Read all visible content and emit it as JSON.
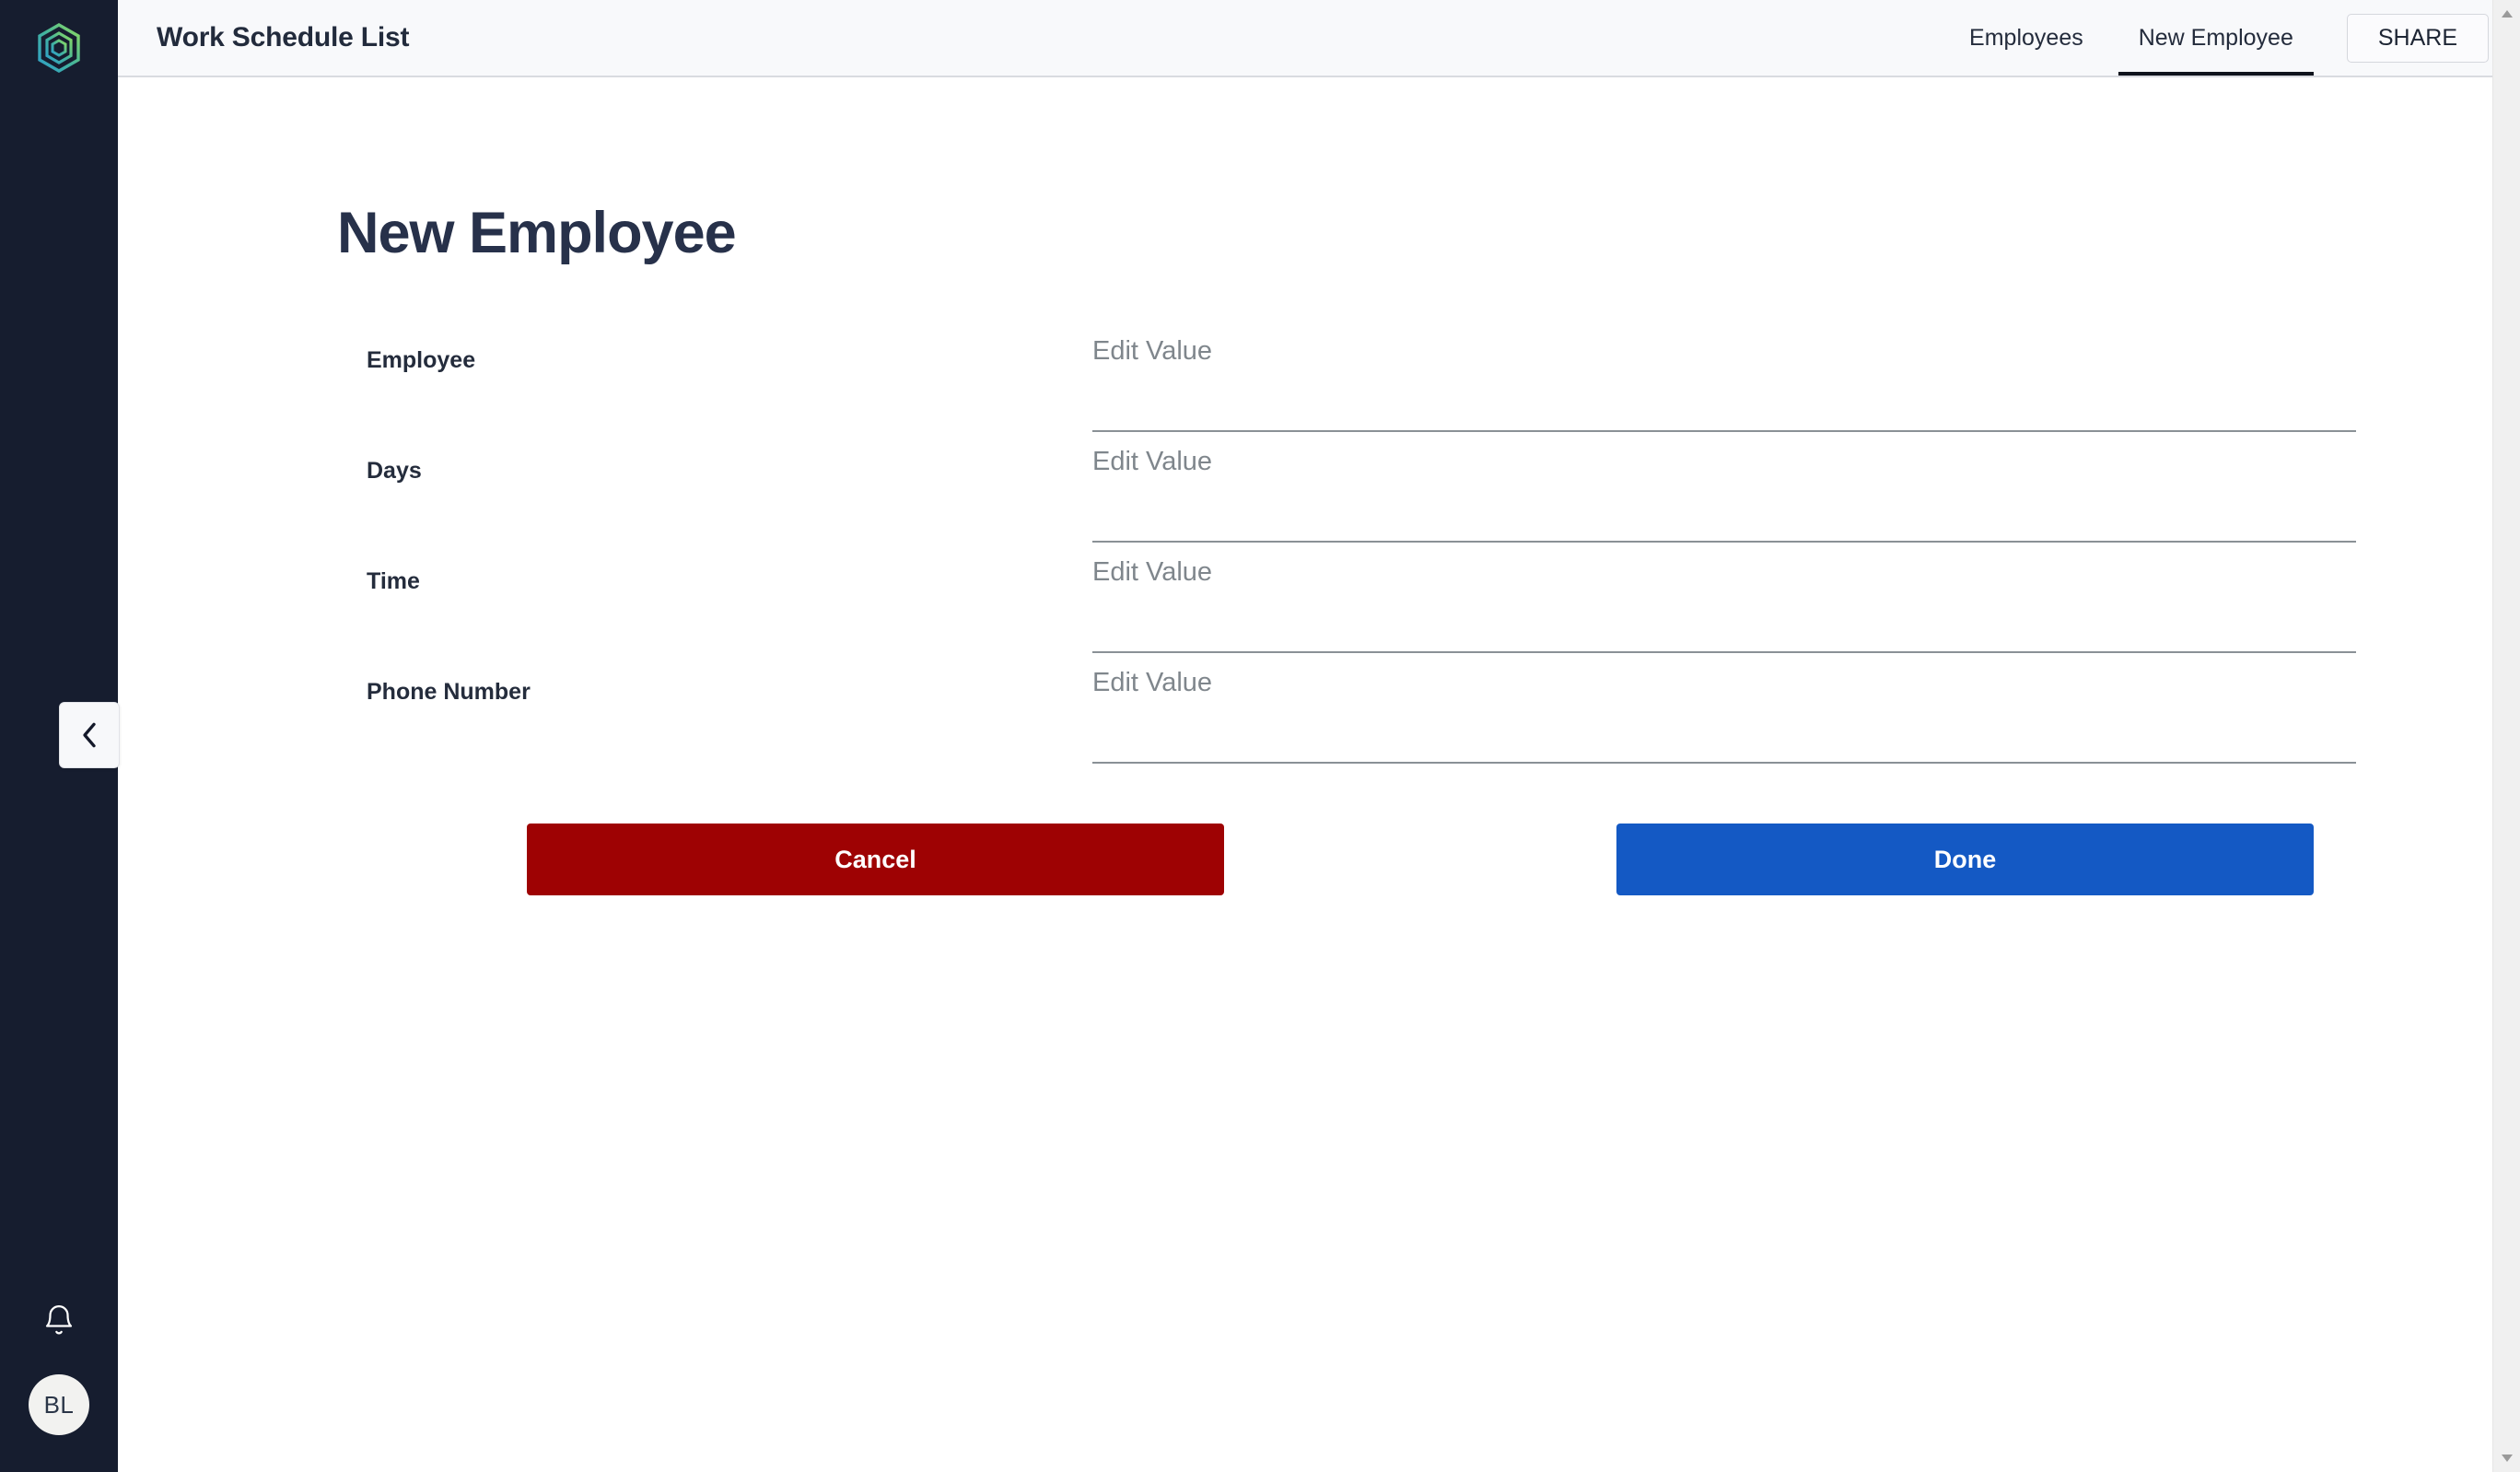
{
  "app": {
    "logo_icon": "hexagon-logo-icon",
    "rail_bg": "#161d2f",
    "accent_teal": "#3aa6c0",
    "accent_green": "#7fd465"
  },
  "sidebar": {
    "notifications_icon": "bell-icon",
    "avatar_initials": "BL",
    "collapse_icon": "chevron-left-icon"
  },
  "header": {
    "title": "Work Schedule List",
    "tabs": [
      {
        "label": "Employees",
        "active": false
      },
      {
        "label": "New Employee",
        "active": true
      }
    ],
    "share_label": "SHARE"
  },
  "main": {
    "page_title": "New Employee",
    "fields": [
      {
        "label": "Employee",
        "value": "",
        "placeholder": "Edit Value"
      },
      {
        "label": "Days",
        "value": "",
        "placeholder": "Edit Value"
      },
      {
        "label": "Time",
        "value": "",
        "placeholder": "Edit Value"
      },
      {
        "label": "Phone Number",
        "value": "",
        "placeholder": "Edit Value"
      }
    ],
    "cancel_label": "Cancel",
    "done_label": "Done",
    "cancel_color": "#9e0203",
    "done_color": "#1459c4"
  },
  "scrollbar": {
    "up_icon": "triangle-up-icon",
    "down_icon": "triangle-down-icon"
  }
}
